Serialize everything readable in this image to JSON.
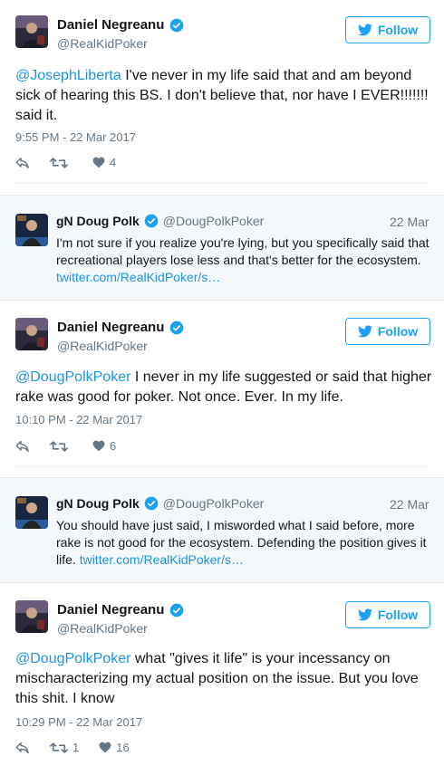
{
  "tweets": [
    {
      "name": "Daniel Negreanu",
      "handle": "@RealKidPoker",
      "follow_label": "Follow",
      "mention": "@JosephLiberta",
      "text": " I've never in my life said that and am beyond sick of hearing this BS. I don't believe that, nor have I EVER!!!!!!! said it.",
      "timestamp": "9:55 PM - 22 Mar 2017",
      "retweets": "",
      "likes": "4"
    },
    {
      "name": "Daniel Negreanu",
      "handle": "@RealKidPoker",
      "follow_label": "Follow",
      "mention": "@DougPolkPoker",
      "text": " I never in my life suggested or said that higher rake was good for poker. Not once. Ever. In my life.",
      "timestamp": "10:10 PM - 22 Mar 2017",
      "retweets": "",
      "likes": "6"
    },
    {
      "name": "Daniel Negreanu",
      "handle": "@RealKidPoker",
      "follow_label": "Follow",
      "mention": "@DougPolkPoker",
      "text": " what \"gives it life\" is your incessancy on mischaracterizing my actual position on the issue. But you love this shit. I know",
      "timestamp": "10:29 PM - 22 Mar 2017",
      "retweets": "1",
      "likes": "16"
    }
  ],
  "quotes": [
    {
      "name": "gN Doug Polk",
      "handle": "@DougPolkPoker",
      "date": "22 Mar",
      "text": "I'm not sure if you realize you're lying, but you specifically said that recreational players lose less and that's better for the ecosystem. ",
      "link": "twitter.com/RealKidPoker/s…"
    },
    {
      "name": "gN Doug Polk",
      "handle": "@DougPolkPoker",
      "date": "22 Mar",
      "text": "You should have just said, I misworded what I said before, more rake is not good for the ecosystem. Defending the position gives it life. ",
      "link": "twitter.com/RealKidPoker/s…"
    }
  ],
  "colors": {
    "accent": "#1da1f2",
    "link": "#1b95e0",
    "muted": "#657786",
    "quote_bg": "#f5f8fa"
  },
  "icons": [
    "verified-badge-icon",
    "twitter-bird-icon",
    "reply-icon",
    "retweet-icon",
    "heart-icon"
  ]
}
